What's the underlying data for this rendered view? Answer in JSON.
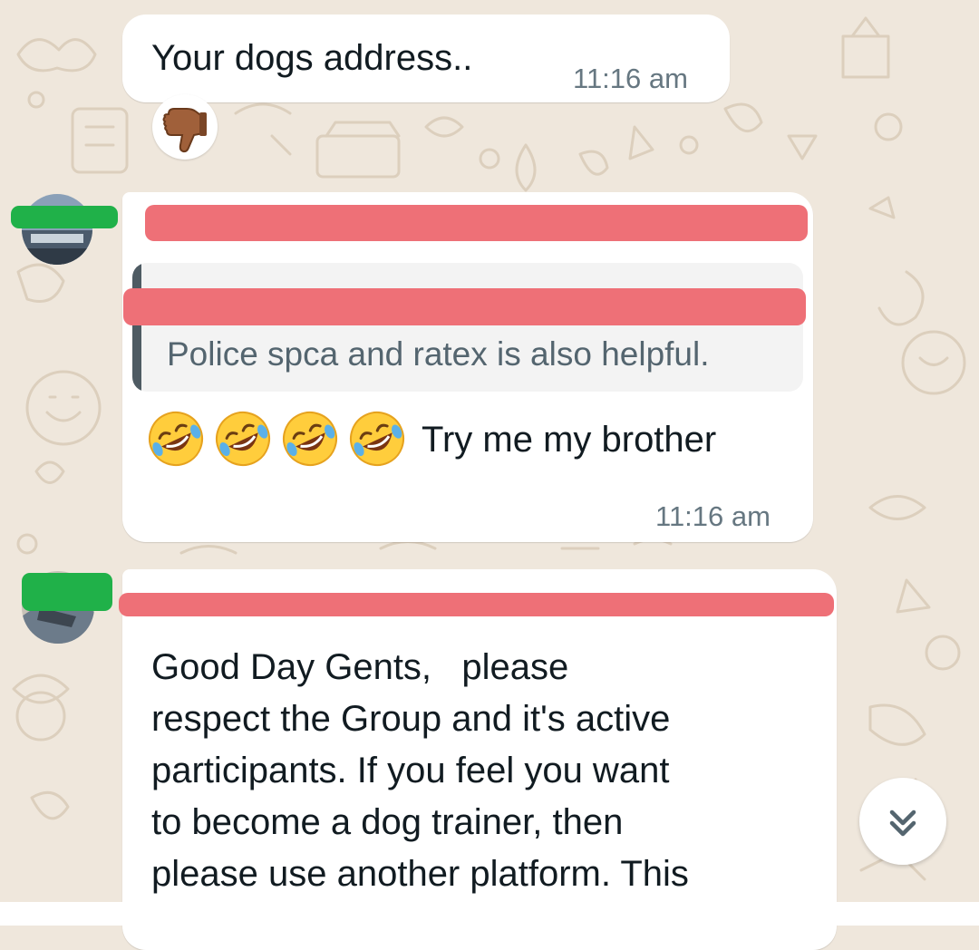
{
  "messages": [
    {
      "id": "msg-1",
      "text": "Your dogs address..",
      "time": "11:16 am",
      "reaction": "thumbs-down-emoji"
    },
    {
      "id": "msg-2",
      "quoted_text": "Police spca and ratex is also helpful.",
      "emojis": [
        "rolling-on-floor-laughing-emoji",
        "rolling-on-floor-laughing-emoji",
        "rolling-on-floor-laughing-emoji",
        "rolling-on-floor-laughing-emoji"
      ],
      "text": "Try me my brother",
      "time": "11:16 am"
    },
    {
      "id": "msg-3",
      "lines": [
        "Good Day Gents,   please",
        "respect the Group and it's active",
        "participants. If you feel you want",
        "to become a dog trainer, then",
        "please use another platform. This"
      ]
    }
  ],
  "scroll_button": {
    "icon": "double-chevron-down-icon"
  },
  "colors": {
    "wallpaper": "#efe7dc",
    "bubble": "#ffffff",
    "redaction": "#ee7077",
    "redaction_tag": "#20b149",
    "timestamp": "#667781",
    "quote_background": "#f3f3f3",
    "quote_bar": "#4e5b63"
  }
}
